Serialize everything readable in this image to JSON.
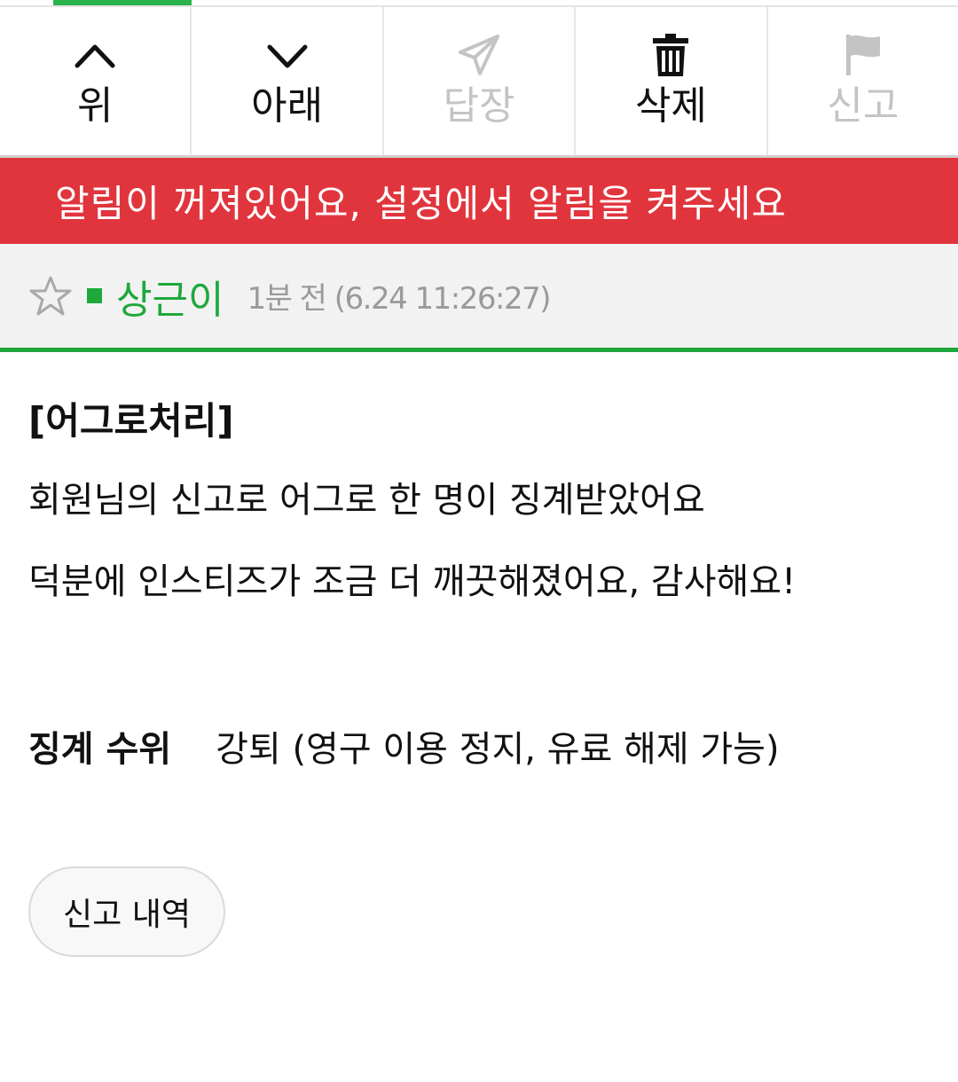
{
  "toolbar": {
    "items": [
      {
        "label": "위",
        "icon": "chevron-up-icon",
        "enabled": true
      },
      {
        "label": "아래",
        "icon": "chevron-down-icon",
        "enabled": true
      },
      {
        "label": "답장",
        "icon": "paper-plane-icon",
        "enabled": false
      },
      {
        "label": "삭제",
        "icon": "trash-icon",
        "enabled": true
      },
      {
        "label": "신고",
        "icon": "flag-icon",
        "enabled": false
      }
    ]
  },
  "banner": {
    "text": "알림이 꺼져있어요, 설정에서 알림을 켜주세요",
    "color": "#e1353d"
  },
  "post": {
    "author": "상근이",
    "time": "1분 전 (6.24 11:26:27)",
    "accent_color": "#1ea83c"
  },
  "content": {
    "headline": "[어그로처리]",
    "line1": "회원님의 신고로 어그로 한 명이 징계받았어요",
    "line2": "덕분에 인스티즈가 조금 더 깨끗해졌어요, 감사해요!",
    "discipline_label": "징계 수위",
    "discipline_value": "강퇴 (영구 이용 정지, 유료 해제 가능)"
  },
  "actions": {
    "history_label": "신고 내역"
  }
}
